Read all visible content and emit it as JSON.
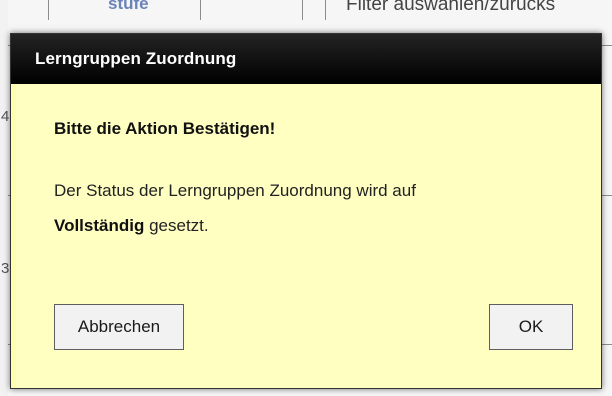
{
  "background": {
    "top_left_text": "stufe",
    "top_right_text": "Filter auswählen/zurücks",
    "row_numbers": [
      "4",
      "3"
    ]
  },
  "dialog": {
    "title": "Lerngruppen Zuordnung",
    "heading": "Bitte die Aktion Bestätigen!",
    "message_prefix": "Der Status der Lerngruppen Zuordnung wird auf",
    "message_status": "Vollständig",
    "message_suffix": "gesetzt.",
    "cancel_label": "Abbrechen",
    "ok_label": "OK"
  },
  "colors": {
    "dialog_background": "#ffffc2",
    "titlebar": "#111111",
    "title_text": "#ffffff"
  }
}
